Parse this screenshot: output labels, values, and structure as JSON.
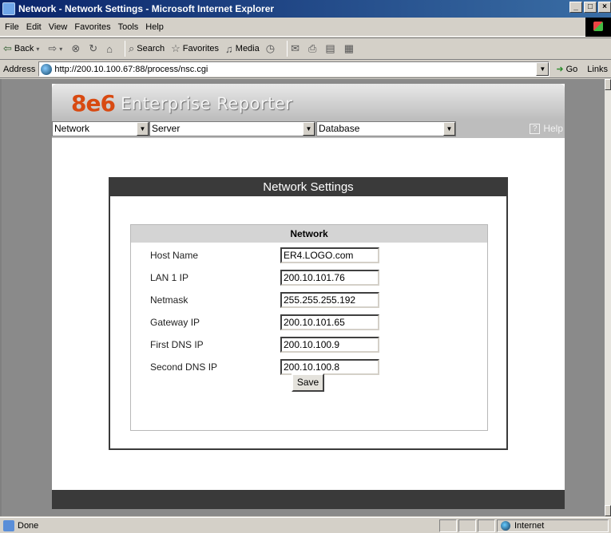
{
  "window": {
    "title": "Network - Network Settings - Microsoft Internet Explorer",
    "min": "_",
    "max": "□",
    "close": "×"
  },
  "menu": [
    "File",
    "Edit",
    "View",
    "Favorites",
    "Tools",
    "Help"
  ],
  "toolbar": {
    "back": "Back",
    "search": "Search",
    "favorites": "Favorites",
    "media": "Media"
  },
  "address": {
    "label": "Address",
    "url": "http://200.10.100.67:88/process/nsc.cgi",
    "go": "Go",
    "links": "Links"
  },
  "app": {
    "logo_brand": "8e6",
    "logo_product": "Enterprise Reporter",
    "nav": {
      "network": "Network",
      "server": "Server",
      "database": "Database",
      "help": "Help"
    }
  },
  "panel": {
    "title": "Network Settings",
    "section_title": "Network",
    "fields": [
      {
        "label": "Host Name",
        "value": "ER4.LOGO.com"
      },
      {
        "label": "LAN 1 IP",
        "value": "200.10.101.76"
      },
      {
        "label": "Netmask",
        "value": "255.255.255.192"
      },
      {
        "label": "Gateway IP",
        "value": "200.10.101.65"
      },
      {
        "label": "First DNS IP",
        "value": "200.10.100.9"
      },
      {
        "label": "Second DNS IP",
        "value": "200.10.100.8"
      }
    ],
    "save_label": "Save"
  },
  "status": {
    "text": "Done",
    "zone": "Internet"
  }
}
